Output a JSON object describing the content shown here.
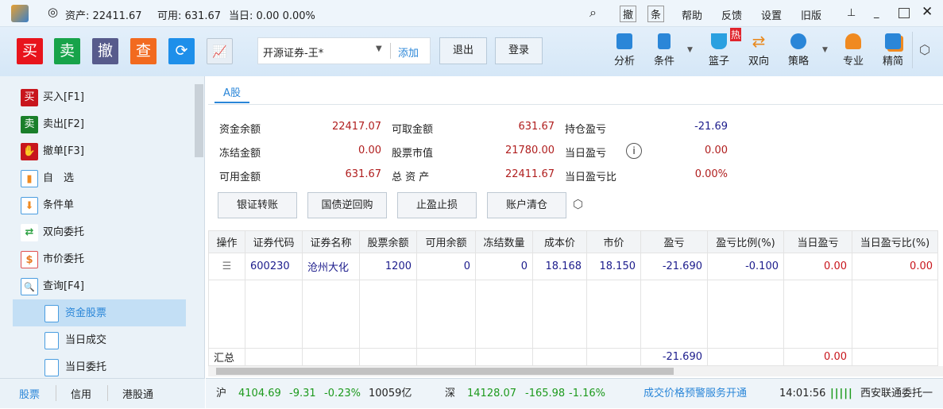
{
  "titlebar": {
    "assets": "资产: 22411.67",
    "available": "可用: 631.67",
    "today": "当日: 0.00 0.00%",
    "btn_cancel": "撤",
    "btn_cond": "条",
    "menu": [
      "帮助",
      "反馈",
      "设置",
      "旧版"
    ]
  },
  "toolbar": {
    "buy": "买",
    "sell": "卖",
    "cancel": "撤",
    "query": "查",
    "account": "开源证券-王*",
    "add": "添加",
    "logout": "退出",
    "login": "登录",
    "tools": [
      {
        "label": "分析",
        "color": "#2a86d8"
      },
      {
        "label": "条件",
        "color": "#2a86d8"
      },
      {
        "label": "篮子",
        "color": "#2aa0e0"
      },
      {
        "label": "双向",
        "color": "#e88a20"
      },
      {
        "label": "策略",
        "color": "#2a86d8"
      },
      {
        "label": "专业",
        "color": "#f08a20"
      },
      {
        "label": "精简",
        "color": "#2a86d8"
      }
    ],
    "hot": "热"
  },
  "sidebar": {
    "items": [
      {
        "label": "买入[F1]",
        "icon": "买",
        "color": "#c8161d"
      },
      {
        "label": "卖出[F2]",
        "icon": "卖",
        "color": "#1a7f2a"
      },
      {
        "label": "撤单[F3]",
        "icon": "✋",
        "color": "#c8161d"
      },
      {
        "label": "自　选",
        "icon": "▮",
        "color": "#4a9de0"
      },
      {
        "label": "条件单",
        "icon": "⬇",
        "color": "#f08a20"
      },
      {
        "label": "双向委托",
        "icon": "⇄",
        "color": "#2aa040"
      },
      {
        "label": "市价委托",
        "icon": "$",
        "color": "#e87a20"
      },
      {
        "label": "查询[F4]",
        "icon": "🔍",
        "color": "#4a9de0"
      }
    ],
    "subitems": [
      "资金股票",
      "当日成交",
      "当日委托"
    ],
    "tabs": [
      "股票",
      "信用",
      "港股通"
    ]
  },
  "main": {
    "tab": "A股",
    "summary": [
      [
        "资金余额",
        "22417.07",
        "可取金额",
        "631.67",
        "持仓盈亏",
        "-21.69"
      ],
      [
        "冻结金额",
        "0.00",
        "股票市值",
        "21780.00",
        "当日盈亏",
        "0.00"
      ],
      [
        "可用金额",
        "631.67",
        "总 资 产",
        "22411.67",
        "当日盈亏比",
        "0.00%"
      ]
    ],
    "actions": [
      "银证转账",
      "国债逆回购",
      "止盈止损",
      "账户清仓"
    ],
    "columns": [
      "操作",
      "证券代码",
      "证券名称",
      "股票余额",
      "可用余额",
      "冻结数量",
      "成本价",
      "市价",
      "盈亏",
      "盈亏比例(%)",
      "当日盈亏",
      "当日盈亏比(%)"
    ],
    "rows": [
      [
        "600230",
        "沧州大化",
        "1200",
        "0",
        "0",
        "18.168",
        "18.150",
        "-21.690",
        "-0.100",
        "0.00",
        "0.00"
      ]
    ],
    "total": {
      "label": "汇总",
      "pnl": "-21.690",
      "today_pnl": "0.00"
    }
  },
  "status": {
    "sh_label": "沪",
    "sh": "4104.69",
    "sh_chg": "-9.31",
    "sh_pct": "-0.23%",
    "sh_vol": "10059亿",
    "sz_label": "深",
    "sz": "14128.07",
    "sz_chg": "-165.98",
    "sz_pct": "-1.16%",
    "promo": "成交价格预警服务开通",
    "time": "14:01:56",
    "broker": "西安联通委托一"
  }
}
